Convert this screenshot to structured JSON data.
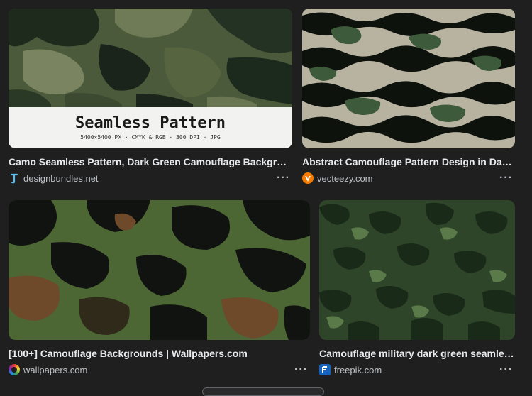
{
  "results": [
    {
      "caption": "Camo Seamless Pattern, Dark Green Camouflage Background",
      "source": "designbundles.net",
      "overlay_title": "Seamless Pattern",
      "overlay_sub": "5400×5400 PX · CMYK & RGB · 300 DPI · JPG",
      "favicon_color": "#1a73e8"
    },
    {
      "caption": "Abstract Camouflage Pattern Design in Dark ...",
      "source": "vecteezy.com",
      "favicon_color": "#f57c00"
    },
    {
      "caption": "[100+] Camouflage Backgrounds | Wallpapers.com",
      "source": "wallpapers.com",
      "favicon_color": "#e53935"
    },
    {
      "caption": "Camouflage military dark green seamless ...",
      "source": "freepik.com",
      "favicon_color": "#1565c0"
    }
  ],
  "more_label": "···"
}
